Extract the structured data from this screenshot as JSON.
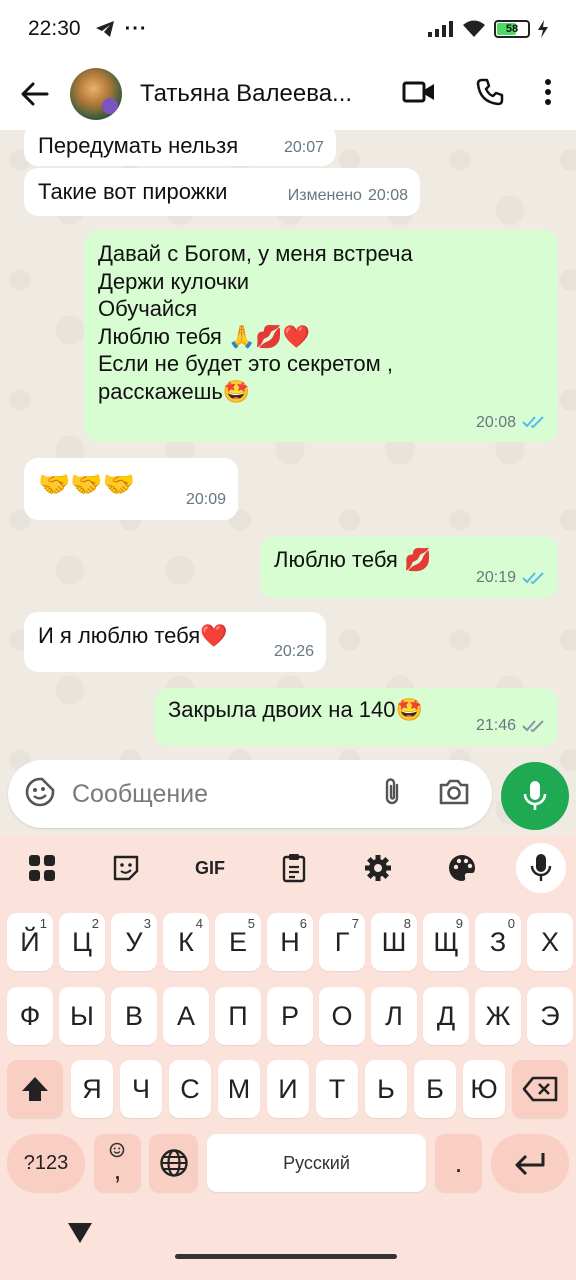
{
  "status_bar": {
    "time": "22:30",
    "dots": "···",
    "battery_level": "58",
    "icons": [
      "telegram-icon",
      "signal-icon",
      "wifi-icon",
      "battery-icon",
      "charging-icon"
    ]
  },
  "header": {
    "contact_name": "Татьяна Валеева..."
  },
  "messages": [
    {
      "id": "m1",
      "direction": "in",
      "text": "Передумать нельзя",
      "time": "20:07",
      "edited": ""
    },
    {
      "id": "m2",
      "direction": "in",
      "text": "Такие вот пирожки",
      "time": "20:08",
      "edited": "Изменено"
    },
    {
      "id": "m3",
      "direction": "out",
      "lines": [
        "Давай с Богом, у меня встреча",
        "Держи кулочки",
        "Обучайся",
        "Люблю тебя 🙏💋❤️",
        "Если не будет это секретом ,",
        "расскажешь🤩"
      ],
      "time": "20:08",
      "status": "read"
    },
    {
      "id": "m4",
      "direction": "in",
      "text": "🤝🤝🤝",
      "time": "20:09"
    },
    {
      "id": "m5",
      "direction": "out",
      "text": "Люблю тебя 💋",
      "time": "20:19",
      "status": "read"
    },
    {
      "id": "m6",
      "direction": "in",
      "text": "И я люблю тебя❤️",
      "time": "20:26"
    },
    {
      "id": "m7",
      "direction": "out",
      "text": "Закрыла двоих на 140🤩",
      "time": "21:46",
      "status": "delivered"
    }
  ],
  "composer": {
    "placeholder": "Сообщение"
  },
  "keyboard": {
    "gif_label": "GIF",
    "row1": [
      {
        "k": "Й",
        "s": "1"
      },
      {
        "k": "Ц",
        "s": "2"
      },
      {
        "k": "У",
        "s": "3"
      },
      {
        "k": "К",
        "s": "4"
      },
      {
        "k": "Е",
        "s": "5"
      },
      {
        "k": "Н",
        "s": "6"
      },
      {
        "k": "Г",
        "s": "7"
      },
      {
        "k": "Ш",
        "s": "8"
      },
      {
        "k": "Щ",
        "s": "9"
      },
      {
        "k": "З",
        "s": "0"
      },
      {
        "k": "Х",
        "s": ""
      }
    ],
    "row2": [
      "Ф",
      "Ы",
      "В",
      "А",
      "П",
      "Р",
      "О",
      "Л",
      "Д",
      "Ж",
      "Э"
    ],
    "row3": [
      "Я",
      "Ч",
      "С",
      "М",
      "И",
      "Т",
      "Ь",
      "Б",
      "Ю"
    ],
    "num_label": "?123",
    "comma": ",",
    "space_label": "Русский",
    "period": "."
  },
  "colors": {
    "outgoing_bubble": "#d9fdd3",
    "incoming_bubble": "#ffffff",
    "chat_bg": "#efeae2",
    "mic_green": "#1ea952",
    "keyboard_bg": "#fbe3dc",
    "read_tick": "#53bdeb"
  }
}
